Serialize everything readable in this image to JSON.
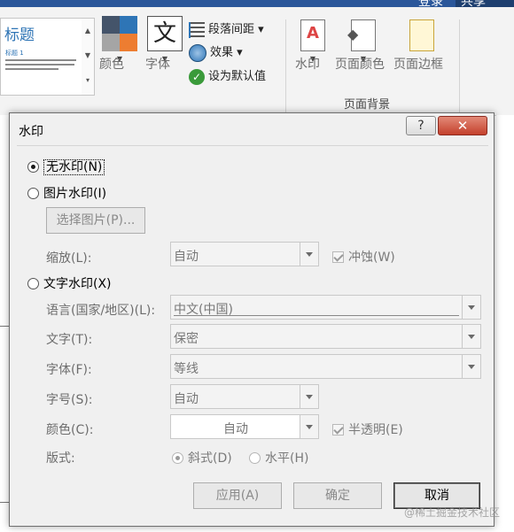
{
  "topbar": {
    "login": "登录",
    "share": "共享"
  },
  "ribbon": {
    "style_gallery": {
      "title": "标题",
      "subtitle": "标题 1"
    },
    "colors_label": "颜色",
    "fonts_label": "字体",
    "paragraph_spacing_label": "段落间距",
    "effects_label": "效果",
    "set_default_label": "设为默认值",
    "watermark_label": "水印",
    "page_color_label": "页面颜色",
    "page_borders_label": "页面边框",
    "page_background_group": "页面背景",
    "colors": {
      "blue": "#2e75b6",
      "orange": "#ed7d31",
      "dark": "#44546a",
      "gray": "#a5a5a5"
    }
  },
  "dialog": {
    "title": "水印",
    "help_glyph": "?",
    "close_glyph": "✕",
    "options": {
      "none": "无水印(N)",
      "picture": "图片水印(I)",
      "text": "文字水印(X)"
    },
    "selected_option": "none",
    "picture": {
      "select_button": "选择图片(P)...",
      "scale_label": "缩放(L):",
      "scale_value": "自动",
      "washout_label": "冲蚀(W)"
    },
    "text": {
      "language_label": "语言(国家/地区)(L):",
      "language_value": "中文(中国)",
      "text_label": "文字(T):",
      "text_value": "保密",
      "font_label": "字体(F):",
      "font_value": "等线",
      "size_label": "字号(S):",
      "size_value": "自动",
      "color_label": "颜色(C):",
      "color_value": "自动",
      "semitransparent_label": "半透明(E)",
      "layout_label": "版式:",
      "diagonal_label": "斜式(D)",
      "horizontal_label": "水平(H)"
    },
    "buttons": {
      "apply": "应用(A)",
      "ok": "确定",
      "cancel": "取消"
    }
  },
  "watermark_overlay": "@稀土掘金技术社区"
}
